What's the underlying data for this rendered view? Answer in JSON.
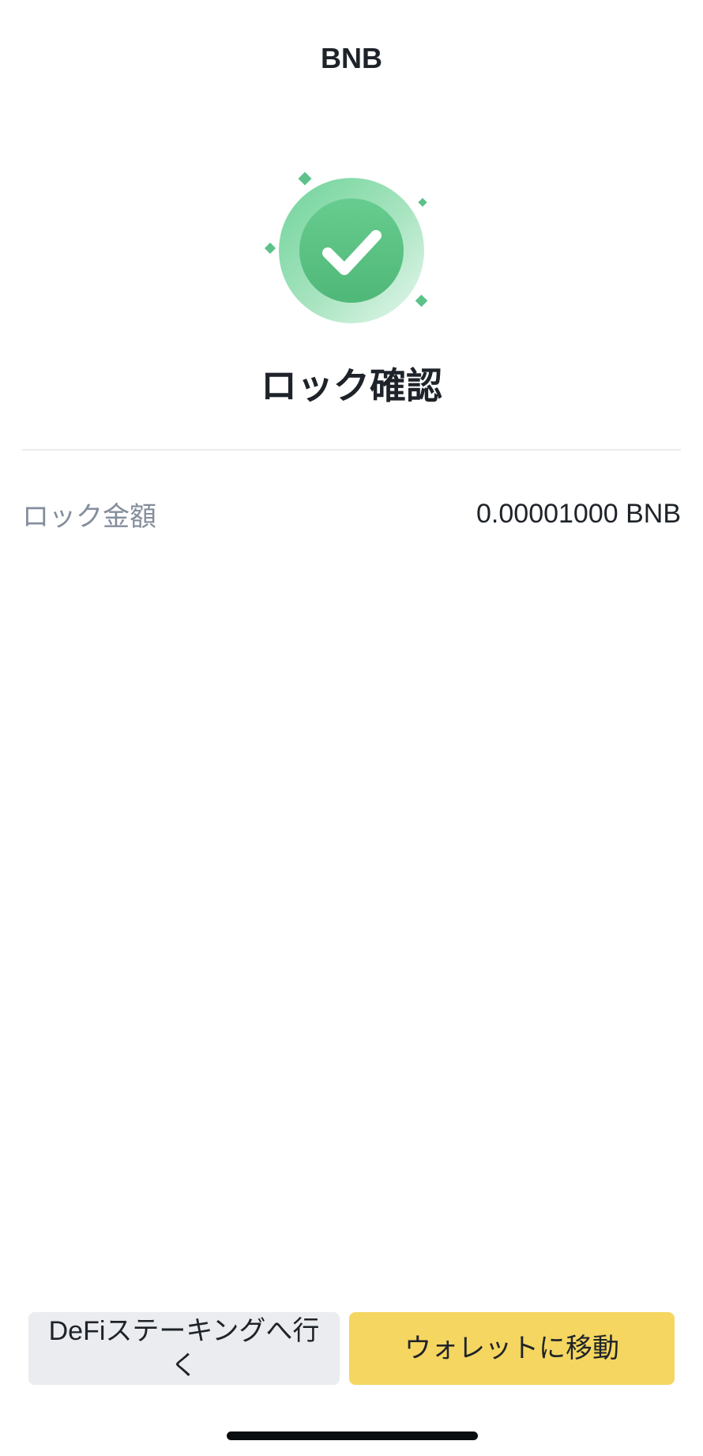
{
  "header": {
    "title": "BNB"
  },
  "status": {
    "icon": "check-circle-icon",
    "title": "ロック確認",
    "colors": {
      "success": "#3DBA7A",
      "success_light": "#CDEFDC"
    }
  },
  "details": {
    "rows": [
      {
        "label": "ロック金額",
        "value": "0.00001000 BNB"
      }
    ]
  },
  "actions": {
    "secondary_label": "DeFiステーキングへ行く",
    "primary_label": "ウォレットに移動",
    "colors": {
      "primary_bg": "#F5D660",
      "secondary_bg": "#EAECEF"
    }
  }
}
